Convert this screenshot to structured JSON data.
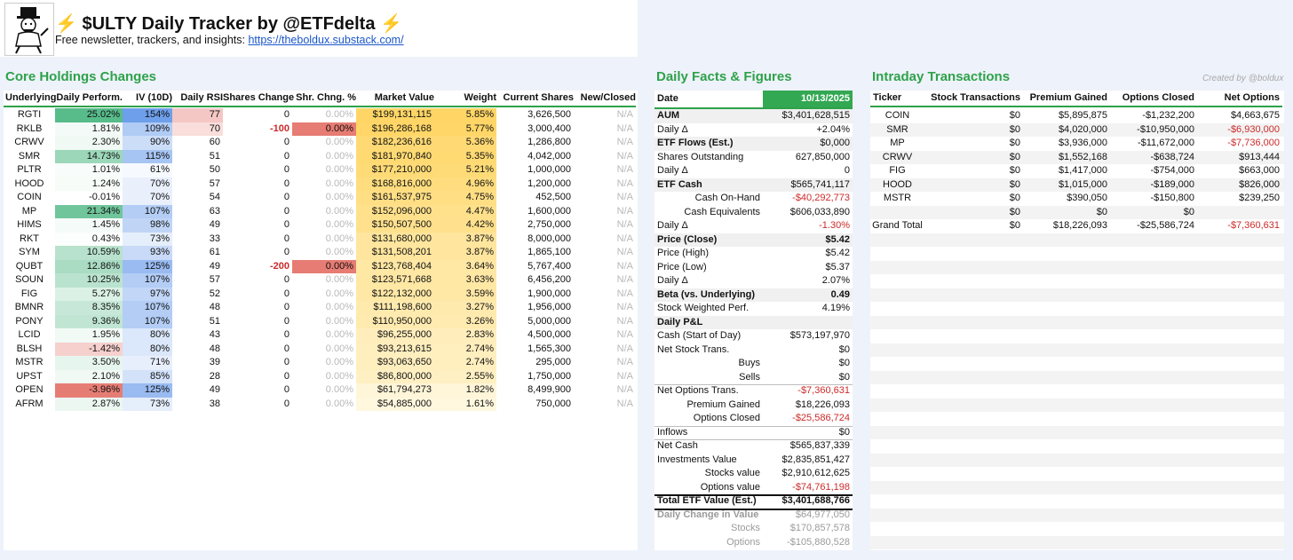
{
  "header": {
    "title_bolt": "⚡",
    "title_text": "$ULTY Daily Tracker by @ETFdelta",
    "subtitle_text": "Free newsletter, trackers, and insights: ",
    "subtitle_link": "https://theboldux.substack.com/"
  },
  "core": {
    "title": "Core Holdings Changes",
    "columns": [
      "Underlying",
      "Daily Perform.",
      "IV (10D)",
      "Daily RSI",
      "Shares Change",
      "Shr. Chng. %",
      "Market Value",
      "Weight",
      "Current Shares",
      "New/Closed"
    ],
    "rows": [
      {
        "t": "RGTI",
        "perf": "25.02%",
        "pv": 25.02,
        "iv": "154%",
        "ivv": 154,
        "rsi": "77",
        "rv": 77,
        "sc": "0",
        "scp": "0.00%",
        "mv": "$199,131,115",
        "w": "5.85%",
        "wv": 5.85,
        "cs": "3,626,500",
        "nc": "N/A"
      },
      {
        "t": "RKLB",
        "perf": "1.81%",
        "pv": 1.81,
        "iv": "109%",
        "ivv": 109,
        "rsi": "70",
        "rv": 70,
        "sc": "-100",
        "scp": "0.00%",
        "mv": "$196,286,168",
        "w": "5.77%",
        "wv": 5.77,
        "cs": "3,000,400",
        "nc": "N/A"
      },
      {
        "t": "CRWV",
        "perf": "2.30%",
        "pv": 2.3,
        "iv": "90%",
        "ivv": 90,
        "rsi": "60",
        "rv": 60,
        "sc": "0",
        "scp": "0.00%",
        "mv": "$182,236,616",
        "w": "5.36%",
        "wv": 5.36,
        "cs": "1,286,800",
        "nc": "N/A"
      },
      {
        "t": "SMR",
        "perf": "14.73%",
        "pv": 14.73,
        "iv": "115%",
        "ivv": 115,
        "rsi": "51",
        "rv": 51,
        "sc": "0",
        "scp": "0.00%",
        "mv": "$181,970,840",
        "w": "5.35%",
        "wv": 5.35,
        "cs": "4,042,000",
        "nc": "N/A"
      },
      {
        "t": "PLTR",
        "perf": "1.01%",
        "pv": 1.01,
        "iv": "61%",
        "ivv": 61,
        "rsi": "50",
        "rv": 50,
        "sc": "0",
        "scp": "0.00%",
        "mv": "$177,210,000",
        "w": "5.21%",
        "wv": 5.21,
        "cs": "1,000,000",
        "nc": "N/A"
      },
      {
        "t": "HOOD",
        "perf": "1.24%",
        "pv": 1.24,
        "iv": "70%",
        "ivv": 70,
        "rsi": "57",
        "rv": 57,
        "sc": "0",
        "scp": "0.00%",
        "mv": "$168,816,000",
        "w": "4.96%",
        "wv": 4.96,
        "cs": "1,200,000",
        "nc": "N/A"
      },
      {
        "t": "COIN",
        "perf": "-0.01%",
        "pv": -0.01,
        "iv": "70%",
        "ivv": 70,
        "rsi": "54",
        "rv": 54,
        "sc": "0",
        "scp": "0.00%",
        "mv": "$161,537,975",
        "w": "4.75%",
        "wv": 4.75,
        "cs": "452,500",
        "nc": "N/A"
      },
      {
        "t": "MP",
        "perf": "21.34%",
        "pv": 21.34,
        "iv": "107%",
        "ivv": 107,
        "rsi": "63",
        "rv": 63,
        "sc": "0",
        "scp": "0.00%",
        "mv": "$152,096,000",
        "w": "4.47%",
        "wv": 4.47,
        "cs": "1,600,000",
        "nc": "N/A"
      },
      {
        "t": "HIMS",
        "perf": "1.45%",
        "pv": 1.45,
        "iv": "98%",
        "ivv": 98,
        "rsi": "49",
        "rv": 49,
        "sc": "0",
        "scp": "0.00%",
        "mv": "$150,507,500",
        "w": "4.42%",
        "wv": 4.42,
        "cs": "2,750,000",
        "nc": "N/A"
      },
      {
        "t": "RKT",
        "perf": "0.43%",
        "pv": 0.43,
        "iv": "73%",
        "ivv": 73,
        "rsi": "33",
        "rv": 33,
        "sc": "0",
        "scp": "0.00%",
        "mv": "$131,680,000",
        "w": "3.87%",
        "wv": 3.87,
        "cs": "8,000,000",
        "nc": "N/A"
      },
      {
        "t": "SYM",
        "perf": "10.59%",
        "pv": 10.59,
        "iv": "93%",
        "ivv": 93,
        "rsi": "61",
        "rv": 61,
        "sc": "0",
        "scp": "0.00%",
        "mv": "$131,508,201",
        "w": "3.87%",
        "wv": 3.87,
        "cs": "1,865,100",
        "nc": "N/A"
      },
      {
        "t": "QUBT",
        "perf": "12.86%",
        "pv": 12.86,
        "iv": "125%",
        "ivv": 125,
        "rsi": "49",
        "rv": 49,
        "sc": "-200",
        "scp": "0.00%",
        "mv": "$123,768,404",
        "w": "3.64%",
        "wv": 3.64,
        "cs": "5,767,400",
        "nc": "N/A"
      },
      {
        "t": "SOUN",
        "perf": "10.25%",
        "pv": 10.25,
        "iv": "107%",
        "ivv": 107,
        "rsi": "57",
        "rv": 57,
        "sc": "0",
        "scp": "0.00%",
        "mv": "$123,571,668",
        "w": "3.63%",
        "wv": 3.63,
        "cs": "6,456,200",
        "nc": "N/A"
      },
      {
        "t": "FIG",
        "perf": "5.27%",
        "pv": 5.27,
        "iv": "97%",
        "ivv": 97,
        "rsi": "52",
        "rv": 52,
        "sc": "0",
        "scp": "0.00%",
        "mv": "$122,132,000",
        "w": "3.59%",
        "wv": 3.59,
        "cs": "1,900,000",
        "nc": "N/A"
      },
      {
        "t": "BMNR",
        "perf": "8.35%",
        "pv": 8.35,
        "iv": "107%",
        "ivv": 107,
        "rsi": "48",
        "rv": 48,
        "sc": "0",
        "scp": "0.00%",
        "mv": "$111,198,600",
        "w": "3.27%",
        "wv": 3.27,
        "cs": "1,956,000",
        "nc": "N/A"
      },
      {
        "t": "PONY",
        "perf": "9.36%",
        "pv": 9.36,
        "iv": "107%",
        "ivv": 107,
        "rsi": "51",
        "rv": 51,
        "sc": "0",
        "scp": "0.00%",
        "mv": "$110,950,000",
        "w": "3.26%",
        "wv": 3.26,
        "cs": "5,000,000",
        "nc": "N/A"
      },
      {
        "t": "LCID",
        "perf": "1.95%",
        "pv": 1.95,
        "iv": "80%",
        "ivv": 80,
        "rsi": "43",
        "rv": 43,
        "sc": "0",
        "scp": "0.00%",
        "mv": "$96,255,000",
        "w": "2.83%",
        "wv": 2.83,
        "cs": "4,500,000",
        "nc": "N/A"
      },
      {
        "t": "BLSH",
        "perf": "-1.42%",
        "pv": -1.42,
        "iv": "80%",
        "ivv": 80,
        "rsi": "48",
        "rv": 48,
        "sc": "0",
        "scp": "0.00%",
        "mv": "$93,213,615",
        "w": "2.74%",
        "wv": 2.74,
        "cs": "1,565,300",
        "nc": "N/A"
      },
      {
        "t": "MSTR",
        "perf": "3.50%",
        "pv": 3.5,
        "iv": "71%",
        "ivv": 71,
        "rsi": "39",
        "rv": 39,
        "sc": "0",
        "scp": "0.00%",
        "mv": "$93,063,650",
        "w": "2.74%",
        "wv": 2.74,
        "cs": "295,000",
        "nc": "N/A"
      },
      {
        "t": "UPST",
        "perf": "2.10%",
        "pv": 2.1,
        "iv": "85%",
        "ivv": 85,
        "rsi": "28",
        "rv": 28,
        "sc": "0",
        "scp": "0.00%",
        "mv": "$86,800,000",
        "w": "2.55%",
        "wv": 2.55,
        "cs": "1,750,000",
        "nc": "N/A"
      },
      {
        "t": "OPEN",
        "perf": "-3.96%",
        "pv": -3.96,
        "iv": "125%",
        "ivv": 125,
        "rsi": "49",
        "rv": 49,
        "sc": "0",
        "scp": "0.00%",
        "mv": "$61,794,273",
        "w": "1.82%",
        "wv": 1.82,
        "cs": "8,499,900",
        "nc": "N/A"
      },
      {
        "t": "AFRM",
        "perf": "2.87%",
        "pv": 2.87,
        "iv": "73%",
        "ivv": 73,
        "rsi": "38",
        "rv": 38,
        "sc": "0",
        "scp": "0.00%",
        "mv": "$54,885,000",
        "w": "1.61%",
        "wv": 1.61,
        "cs": "750,000",
        "nc": "N/A"
      }
    ]
  },
  "facts": {
    "title": "Daily Facts & Figures",
    "date_label": "Date",
    "date_value": "10/13/2025",
    "rows": [
      {
        "label": "AUM",
        "value": "$3,401,628,515",
        "style": "bold-gray"
      },
      {
        "label": "Daily Δ",
        "value": "+2.04%",
        "style": "line"
      },
      {
        "label": "ETF Flows (Est.)",
        "value": "$0,000",
        "style": "bold-gray"
      },
      {
        "label": "Shares Outstanding",
        "value": "627,850,000"
      },
      {
        "label": "Daily Δ",
        "value": "0",
        "style": "line"
      },
      {
        "label": "ETF Cash",
        "value": "$565,741,117",
        "style": "bold-gray"
      },
      {
        "label": "Cash On-Hand",
        "value": "-$40,292,773",
        "style": "indent neg"
      },
      {
        "label": "Cash Equivalents",
        "value": "$606,033,890",
        "style": "indent"
      },
      {
        "label": "Daily Δ",
        "value": "-1.30%",
        "style": "neg line"
      },
      {
        "label": "Price (Close)",
        "value": "$5.42",
        "style": "bold-gray bold-val"
      },
      {
        "label": "Price (High)",
        "value": "$5.42"
      },
      {
        "label": "Price (Low)",
        "value": "$5.37"
      },
      {
        "label": "Daily Δ",
        "value": "2.07%",
        "style": "line"
      },
      {
        "label": "Beta (vs. Underlying)",
        "value": "0.49",
        "style": "bold-gray bold-val"
      },
      {
        "label": "Stock Weighted Perf.",
        "value": "4.19%",
        "style": "line"
      },
      {
        "label": "Daily P&L",
        "value": "",
        "style": "bold-gray"
      },
      {
        "label": "Cash (Start of Day)",
        "value": "$573,197,970"
      },
      {
        "label": "Net Stock Trans.",
        "value": "$0"
      },
      {
        "label": "Buys",
        "value": "$0",
        "style": "indent"
      },
      {
        "label": "Sells",
        "value": "$0",
        "style": "indent line"
      },
      {
        "label": "Net Options Trans.",
        "value": "-$7,360,631",
        "style": "neg"
      },
      {
        "label": "Premium Gained",
        "value": "$18,226,093",
        "style": "indent"
      },
      {
        "label": "Options Closed",
        "value": "-$25,586,724",
        "style": "indent neg line"
      },
      {
        "label": "Inflows",
        "value": "$0",
        "style": "line"
      },
      {
        "label": "Net Cash",
        "value": "$565,837,339"
      },
      {
        "label": "Investments Value",
        "value": "$2,835,851,427"
      },
      {
        "label": "Stocks value",
        "value": "$2,910,612,625",
        "style": "indent"
      },
      {
        "label": "Options value",
        "value": "-$74,761,198",
        "style": "indent neg thick"
      },
      {
        "label": "Total ETF Value (Est.)",
        "value": "$3,401,688,766",
        "style": "bold bold-val thick"
      },
      {
        "label": "Daily Change in Value",
        "value": "$64,977,050",
        "style": "gray-text gray-bold"
      },
      {
        "label": "Stocks",
        "value": "$170,857,578",
        "style": "gray-text indent"
      },
      {
        "label": "Options",
        "value": "-$105,880,528",
        "style": "gray-text indent"
      }
    ]
  },
  "intraday": {
    "title": "Intraday Transactions",
    "credit": "Created by @boldux",
    "columns": [
      "Ticker",
      "Stock Transactions",
      "Premium Gained",
      "Options Closed",
      "Net Options"
    ],
    "rows": [
      {
        "t": "COIN",
        "st": "$0",
        "pg": "$5,895,875",
        "oc": "-$1,232,200",
        "no": "$4,663,675",
        "neg": false
      },
      {
        "t": "SMR",
        "st": "$0",
        "pg": "$4,020,000",
        "oc": "-$10,950,000",
        "no": "-$6,930,000",
        "neg": true
      },
      {
        "t": "MP",
        "st": "$0",
        "pg": "$3,936,000",
        "oc": "-$11,672,000",
        "no": "-$7,736,000",
        "neg": true
      },
      {
        "t": "CRWV",
        "st": "$0",
        "pg": "$1,552,168",
        "oc": "-$638,724",
        "no": "$913,444",
        "neg": false
      },
      {
        "t": "FIG",
        "st": "$0",
        "pg": "$1,417,000",
        "oc": "-$754,000",
        "no": "$663,000",
        "neg": false
      },
      {
        "t": "HOOD",
        "st": "$0",
        "pg": "$1,015,000",
        "oc": "-$189,000",
        "no": "$826,000",
        "neg": false
      },
      {
        "t": "MSTR",
        "st": "$0",
        "pg": "$390,050",
        "oc": "-$150,800",
        "no": "$239,250",
        "neg": false
      },
      {
        "t": "",
        "st": "$0",
        "pg": "$0",
        "oc": "$0",
        "no": "",
        "neg": false
      },
      {
        "t": "Grand Total",
        "st": "$0",
        "pg": "$18,226,093",
        "oc": "-$25,586,724",
        "no": "-$7,360,631",
        "neg": true
      }
    ]
  },
  "colors": {
    "accent_green": "#2ea24a",
    "date_green": "#33a852",
    "negative_red": "#cc2a2a",
    "perf_green": "#57bb8a",
    "perf_red": "#e67c73",
    "iv_blue": "#6d9eeb",
    "weight_yellow": "#ffd666",
    "scp_red": "#e67c73"
  }
}
